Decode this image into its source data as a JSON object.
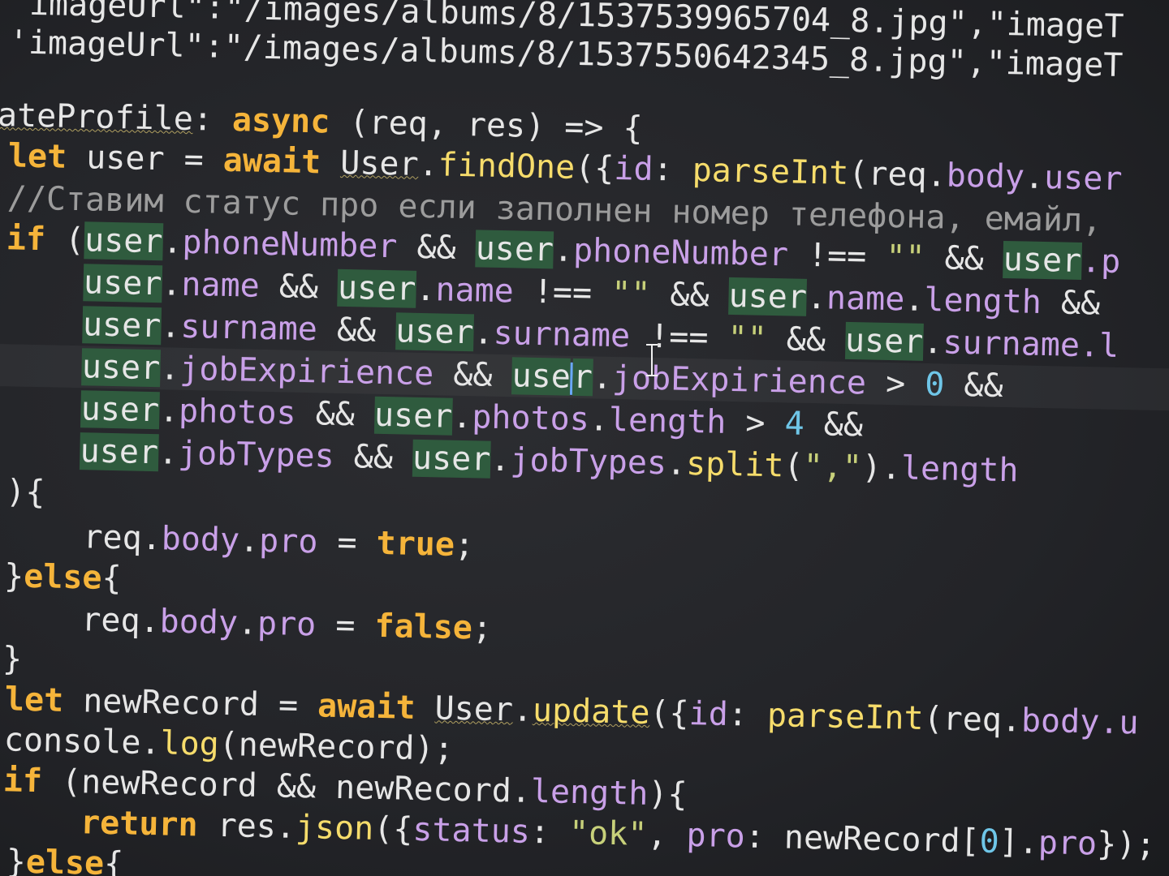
{
  "editor": {
    "lines": [
      [
        {
          "t": "'imageUrl\":\"/images/albums/8/1537539965704_8.jpg\",\"imageT",
          "c": "op"
        }
      ],
      [
        {
          "t": "'imageUrl\":\"/images/albums/8/1537550642345_8.jpg\",\"imageT",
          "c": "op"
        }
      ],
      [],
      [
        {
          "t": "ateProfile",
          "c": "op uline"
        },
        {
          "t": ": ",
          "c": "op"
        },
        {
          "t": "async",
          "c": "kw"
        },
        {
          "t": " (req, res) => {",
          "c": "op"
        }
      ],
      [
        {
          "t": "let ",
          "c": "kw"
        },
        {
          "t": "user",
          "c": "op"
        },
        {
          "t": " = ",
          "c": "op"
        },
        {
          "t": "await ",
          "c": "kw"
        },
        {
          "t": "User",
          "c": "op uline"
        },
        {
          "t": ".",
          "c": "op"
        },
        {
          "t": "findOne",
          "c": "fn"
        },
        {
          "t": "({",
          "c": "op"
        },
        {
          "t": "id",
          "c": "prop"
        },
        {
          "t": ": ",
          "c": "op"
        },
        {
          "t": "parseInt",
          "c": "fn"
        },
        {
          "t": "(req.",
          "c": "op"
        },
        {
          "t": "body",
          "c": "prop"
        },
        {
          "t": ".",
          "c": "op"
        },
        {
          "t": "user",
          "c": "prop"
        }
      ],
      [
        {
          "t": "//Ставим статус про если заполнен номер телефона, емайл, ",
          "c": "cmt"
        }
      ],
      [
        {
          "t": "if ",
          "c": "kw"
        },
        {
          "t": "(",
          "c": "op"
        },
        {
          "t": "user",
          "c": "op hl"
        },
        {
          "t": ".",
          "c": "op"
        },
        {
          "t": "phoneNumber",
          "c": "prop"
        },
        {
          "t": " && ",
          "c": "op"
        },
        {
          "t": "user",
          "c": "op hl"
        },
        {
          "t": ".",
          "c": "op"
        },
        {
          "t": "phoneNumber",
          "c": "prop"
        },
        {
          "t": " !== ",
          "c": "op"
        },
        {
          "t": "\"\"",
          "c": "str"
        },
        {
          "t": " && ",
          "c": "op"
        },
        {
          "t": "user",
          "c": "op hl"
        },
        {
          "t": ".p",
          "c": "prop"
        }
      ],
      [
        {
          "t": "    ",
          "c": "op"
        },
        {
          "t": "user",
          "c": "op hl"
        },
        {
          "t": ".",
          "c": "op"
        },
        {
          "t": "name",
          "c": "prop"
        },
        {
          "t": " && ",
          "c": "op"
        },
        {
          "t": "user",
          "c": "op hl"
        },
        {
          "t": ".",
          "c": "op"
        },
        {
          "t": "name",
          "c": "prop"
        },
        {
          "t": " !== ",
          "c": "op"
        },
        {
          "t": "\"\"",
          "c": "str"
        },
        {
          "t": " && ",
          "c": "op"
        },
        {
          "t": "user",
          "c": "op hl"
        },
        {
          "t": ".",
          "c": "op"
        },
        {
          "t": "name",
          "c": "prop"
        },
        {
          "t": ".",
          "c": "op"
        },
        {
          "t": "length",
          "c": "prop"
        },
        {
          "t": " &&",
          "c": "op"
        }
      ],
      [
        {
          "t": "    ",
          "c": "op"
        },
        {
          "t": "user",
          "c": "op hl"
        },
        {
          "t": ".",
          "c": "op"
        },
        {
          "t": "surname",
          "c": "prop"
        },
        {
          "t": " && ",
          "c": "op"
        },
        {
          "t": "user",
          "c": "op hl"
        },
        {
          "t": ".",
          "c": "op"
        },
        {
          "t": "surname",
          "c": "prop"
        },
        {
          "t": " !== ",
          "c": "op"
        },
        {
          "t": "\"\"",
          "c": "str"
        },
        {
          "t": " && ",
          "c": "op"
        },
        {
          "t": "user",
          "c": "op hl"
        },
        {
          "t": ".",
          "c": "op"
        },
        {
          "t": "surname",
          "c": "prop"
        },
        {
          "t": ".l",
          "c": "prop"
        }
      ],
      [
        {
          "t": "    ",
          "c": "op"
        },
        {
          "t": "user",
          "c": "op hl"
        },
        {
          "t": ".",
          "c": "op"
        },
        {
          "t": "jobExpirience",
          "c": "prop"
        },
        {
          "t": " && ",
          "c": "op"
        },
        {
          "t": "use",
          "c": "op hl"
        },
        {
          "t": "",
          "c": "cursor"
        },
        {
          "t": "r",
          "c": "op hl"
        },
        {
          "t": ".",
          "c": "op"
        },
        {
          "t": "jobExpirience",
          "c": "prop"
        },
        {
          "t": " > ",
          "c": "op"
        },
        {
          "t": "0",
          "c": "num"
        },
        {
          "t": " &&",
          "c": "op"
        }
      ],
      [
        {
          "t": "    ",
          "c": "op"
        },
        {
          "t": "user",
          "c": "op hl"
        },
        {
          "t": ".",
          "c": "op"
        },
        {
          "t": "photos",
          "c": "prop"
        },
        {
          "t": " && ",
          "c": "op"
        },
        {
          "t": "user",
          "c": "op hl"
        },
        {
          "t": ".",
          "c": "op"
        },
        {
          "t": "photos",
          "c": "prop"
        },
        {
          "t": ".",
          "c": "op"
        },
        {
          "t": "length",
          "c": "prop"
        },
        {
          "t": " > ",
          "c": "op"
        },
        {
          "t": "4",
          "c": "num"
        },
        {
          "t": " &&",
          "c": "op"
        }
      ],
      [
        {
          "t": "    ",
          "c": "op"
        },
        {
          "t": "user",
          "c": "op hl"
        },
        {
          "t": ".",
          "c": "op"
        },
        {
          "t": "jobTypes",
          "c": "prop"
        },
        {
          "t": " && ",
          "c": "op"
        },
        {
          "t": "user",
          "c": "op hl"
        },
        {
          "t": ".",
          "c": "op"
        },
        {
          "t": "jobTypes",
          "c": "prop"
        },
        {
          "t": ".",
          "c": "op"
        },
        {
          "t": "split",
          "c": "fn"
        },
        {
          "t": "(",
          "c": "op"
        },
        {
          "t": "\",\"",
          "c": "str"
        },
        {
          "t": ").",
          "c": "op"
        },
        {
          "t": "length",
          "c": "prop"
        }
      ],
      [
        {
          "t": "){",
          "c": "op"
        }
      ],
      [
        {
          "t": "    req.",
          "c": "op"
        },
        {
          "t": "body",
          "c": "prop"
        },
        {
          "t": ".",
          "c": "op"
        },
        {
          "t": "pro",
          "c": "prop"
        },
        {
          "t": " = ",
          "c": "op"
        },
        {
          "t": "true",
          "c": "kw"
        },
        {
          "t": ";",
          "c": "op"
        }
      ],
      [
        {
          "t": "}",
          "c": "op"
        },
        {
          "t": "else",
          "c": "kw"
        },
        {
          "t": "{",
          "c": "op"
        }
      ],
      [
        {
          "t": "    req.",
          "c": "op"
        },
        {
          "t": "body",
          "c": "prop"
        },
        {
          "t": ".",
          "c": "op"
        },
        {
          "t": "pro",
          "c": "prop"
        },
        {
          "t": " = ",
          "c": "op"
        },
        {
          "t": "false",
          "c": "kw"
        },
        {
          "t": ";",
          "c": "op"
        }
      ],
      [
        {
          "t": "}",
          "c": "op"
        }
      ],
      [
        {
          "t": "let ",
          "c": "kw"
        },
        {
          "t": "newRecord = ",
          "c": "op"
        },
        {
          "t": "await ",
          "c": "kw"
        },
        {
          "t": "User",
          "c": "op uline"
        },
        {
          "t": ".",
          "c": "op"
        },
        {
          "t": "update",
          "c": "fn uline"
        },
        {
          "t": "({",
          "c": "op"
        },
        {
          "t": "id",
          "c": "prop"
        },
        {
          "t": ": ",
          "c": "op"
        },
        {
          "t": "parseInt",
          "c": "fn"
        },
        {
          "t": "(req.",
          "c": "op"
        },
        {
          "t": "body",
          "c": "prop"
        },
        {
          "t": ".u",
          "c": "prop"
        }
      ],
      [
        {
          "t": "console.",
          "c": "op"
        },
        {
          "t": "log",
          "c": "fn"
        },
        {
          "t": "(newRecord);",
          "c": "op"
        }
      ],
      [
        {
          "t": "if ",
          "c": "kw"
        },
        {
          "t": "(newRecord && newRecord.",
          "c": "op"
        },
        {
          "t": "length",
          "c": "prop"
        },
        {
          "t": "){",
          "c": "op"
        }
      ],
      [
        {
          "t": "    ",
          "c": "op"
        },
        {
          "t": "return ",
          "c": "kw"
        },
        {
          "t": "res.",
          "c": "op"
        },
        {
          "t": "json",
          "c": "fn"
        },
        {
          "t": "({",
          "c": "op"
        },
        {
          "t": "status",
          "c": "prop"
        },
        {
          "t": ": ",
          "c": "op"
        },
        {
          "t": "\"ok\"",
          "c": "str"
        },
        {
          "t": ", ",
          "c": "op"
        },
        {
          "t": "pro",
          "c": "prop"
        },
        {
          "t": ": newRecord[",
          "c": "op"
        },
        {
          "t": "0",
          "c": "num"
        },
        {
          "t": "].",
          "c": "op"
        },
        {
          "t": "pro",
          "c": "prop"
        },
        {
          "t": "});",
          "c": "op"
        }
      ],
      [
        {
          "t": "}",
          "c": "op"
        },
        {
          "t": "else",
          "c": "kw"
        },
        {
          "t": "{",
          "c": "op"
        }
      ]
    ]
  }
}
